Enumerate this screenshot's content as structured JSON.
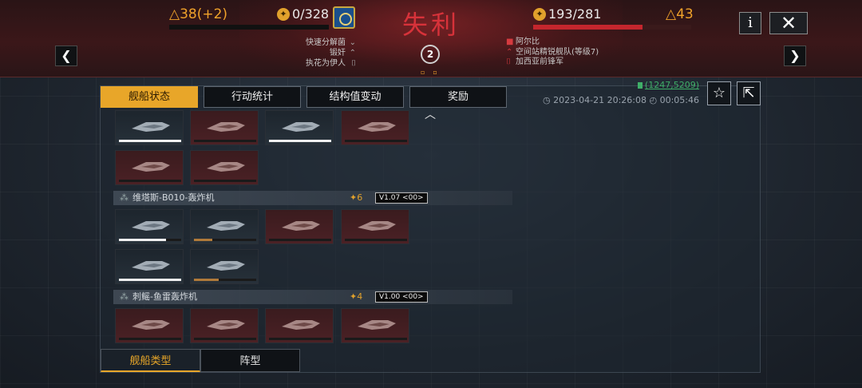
{
  "header": {
    "title": "失利",
    "left": {
      "delta": "△38(+2)",
      "coins": "0/328"
    },
    "right": {
      "coins": "193/281",
      "delta": "△43",
      "hp_fraction": 0.69
    },
    "info_label": "i",
    "close_label": "✕",
    "prev_label": "❮",
    "next_label": "❯",
    "round": "2",
    "left_tactics": [
      "快速分解菌",
      "锻奸",
      "执花为伊人"
    ],
    "right_info": [
      "阿尔比",
      "空间站精锐舰队(等级7)",
      "加西亚前锋军"
    ]
  },
  "tabs": [
    {
      "label": "舰船状态",
      "active": true
    },
    {
      "label": "行动统计",
      "active": false
    },
    {
      "label": "结构值变动",
      "active": false
    },
    {
      "label": "奖励",
      "active": false
    }
  ],
  "meta": {
    "coords": "(1247,5209)",
    "datetime": "2023-04-21 20:26:08",
    "duration": "00:05:46"
  },
  "groups": [
    {
      "name": "维塔斯-B010-轰炸机",
      "count": "6",
      "version": "V1.07 <00>"
    },
    {
      "name": "刺鳐-鱼雷轰炸机",
      "count": "4",
      "version": "V1.00 <00>"
    }
  ],
  "ships": {
    "row1": [
      {
        "state": "alive",
        "hp": 1.0
      },
      {
        "state": "dead",
        "hp": 0.0
      },
      {
        "state": "alive",
        "hp": 1.0
      },
      {
        "state": "dead",
        "hp": 0.0
      }
    ],
    "row2": [
      {
        "state": "dead",
        "hp": 0.0
      },
      {
        "state": "dead",
        "hp": 0.0
      }
    ],
    "row3": [
      {
        "state": "alive",
        "hp": 0.75
      },
      {
        "state": "alive",
        "hp": 0.3
      },
      {
        "state": "dead",
        "hp": 0.0
      },
      {
        "state": "dead",
        "hp": 0.0
      }
    ],
    "row4": [
      {
        "state": "alive",
        "hp": 1.0
      },
      {
        "state": "alive",
        "hp": 0.4
      }
    ],
    "row5": [
      {
        "state": "dead",
        "hp": 0.0
      },
      {
        "state": "dead",
        "hp": 0.0
      },
      {
        "state": "dead",
        "hp": 0.0
      },
      {
        "state": "dead",
        "hp": 0.0
      }
    ]
  },
  "bottom_tabs": [
    {
      "label": "舰船类型",
      "active": true
    },
    {
      "label": "阵型",
      "active": false
    }
  ],
  "colors": {
    "accent": "#e8a629",
    "defeat_red": "#d7323a",
    "hp_full": "#f0f0f0",
    "hp_damaged": "#b07a3a"
  }
}
